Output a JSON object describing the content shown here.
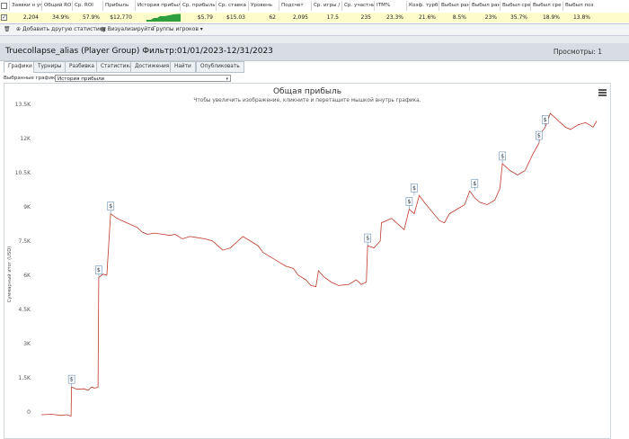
{
  "stats_table": {
    "headers": [
      "Заявки н уп",
      "Общий ROI",
      "Ср. ROI",
      "Прибыль",
      "История прибыли",
      "Ср. прибыль",
      "Ср. ставка",
      "Уровень",
      "Подсчет",
      "Ср. игры / ...",
      "Ср. участни",
      "ITM%",
      "Коэф. турби",
      "Выбыл ран",
      "Выбыл ран",
      "Выбыл сре",
      "Выбыл сре",
      "Выбыл поз"
    ],
    "row": [
      "2,204",
      "34.9%",
      "57.9%",
      "$12,770",
      "",
      "$5.79",
      "$15.03",
      "62",
      "2,095",
      "17.5",
      "235",
      "23.3%",
      "21.6%",
      "8.5%",
      "23%",
      "35.7%",
      "18.9%",
      "13.8%"
    ],
    "checked_mark": "✓"
  },
  "toolbar": {
    "add_stat": "Добавить другую статистику",
    "visualize": "Визуализируйте",
    "player_groups": "Группы игроков"
  },
  "panel": {
    "title": "Truecollapse_alias (Player Group) Фильтр:01/01/2023-12/31/2023",
    "views": "Просмотры: 1",
    "tabs": [
      "Графики",
      "Турниры",
      "Разбивка",
      "Статистика",
      "Достижения",
      "Найти",
      "Опубликовать"
    ],
    "selected_graphs_label": "Выбранные графики:",
    "selected_graph": "История прибыли"
  },
  "chart_data": {
    "type": "line",
    "title": "Общая прибыль",
    "subtitle": "Чтобы увеличить изображение, кликните и перетащите мышкой внутрь графика.",
    "ylabel": "Суммарный итог (USD)",
    "xlabel": "",
    "ylim": [
      -300,
      13500
    ],
    "yticks": [
      0,
      1500,
      3000,
      4500,
      6000,
      7500,
      9000,
      10500,
      12000,
      13500
    ],
    "ytick_labels": [
      "0",
      "1.5K",
      "3K",
      "4.5K",
      "6K",
      "7.5K",
      "9K",
      "10.5K",
      "12K",
      "13.5K"
    ],
    "xlim": [
      0,
      2204
    ],
    "series": [
      {
        "color": "#c0392b",
        "x": [
          0,
          40,
          80,
          100,
          118,
          120,
          140,
          170,
          185,
          200,
          210,
          225,
          228,
          245,
          260,
          275,
          300,
          320,
          340,
          360,
          380,
          400,
          420,
          450,
          480,
          510,
          530,
          560,
          590,
          620,
          650,
          680,
          700,
          720,
          750,
          780,
          800,
          830,
          860,
          880,
          910,
          940,
          970,
          1000,
          1020,
          1050,
          1070,
          1090,
          1100,
          1120,
          1150,
          1180,
          1220,
          1250,
          1270,
          1290,
          1295,
          1320,
          1345,
          1350,
          1370,
          1390,
          1420,
          1440,
          1460,
          1480,
          1500,
          1520,
          1550,
          1580,
          1600,
          1620,
          1650,
          1680,
          1700,
          1720,
          1740,
          1770,
          1800,
          1820,
          1830,
          1860,
          1890,
          1920,
          1950,
          1975,
          1980,
          2000,
          2020,
          2050,
          2080,
          2100,
          2130,
          2160,
          2190,
          2204
        ],
        "y": [
          -120,
          -100,
          -150,
          -120,
          -180,
          1100,
          1000,
          1020,
          950,
          1100,
          1050,
          1080,
          5900,
          6050,
          6000,
          8700,
          8500,
          8400,
          8300,
          8200,
          8100,
          7900,
          7800,
          7850,
          7800,
          7750,
          7800,
          7600,
          7700,
          7650,
          7600,
          7500,
          7300,
          7100,
          7200,
          7500,
          7700,
          7500,
          7300,
          7000,
          6800,
          6600,
          6400,
          6300,
          6000,
          5800,
          5550,
          5500,
          6200,
          5950,
          5700,
          5550,
          5600,
          5800,
          5600,
          5700,
          7300,
          7200,
          7500,
          8300,
          8400,
          8500,
          8200,
          8000,
          8900,
          8700,
          9500,
          9200,
          8800,
          8400,
          8300,
          8700,
          8900,
          9100,
          9700,
          9400,
          9200,
          9100,
          9300,
          9800,
          10900,
          10600,
          10400,
          10600,
          11300,
          11800,
          12200,
          12500,
          13100,
          12800,
          12500,
          12400,
          12600,
          12700,
          12500,
          12770
        ]
      }
    ],
    "markers": [
      {
        "x": 120,
        "y": 1100
      },
      {
        "x": 228,
        "y": 5900
      },
      {
        "x": 275,
        "y": 8700
      },
      {
        "x": 1295,
        "y": 7300
      },
      {
        "x": 1460,
        "y": 8900
      },
      {
        "x": 1480,
        "y": 9500
      },
      {
        "x": 1720,
        "y": 9700
      },
      {
        "x": 1830,
        "y": 10900
      },
      {
        "x": 1975,
        "y": 11800
      },
      {
        "x": 2000,
        "y": 12500
      }
    ],
    "marker_label": "$",
    "grid": false,
    "legend": "none"
  },
  "colors": {
    "highlight_row": "#fffccc",
    "line": "#c0392b",
    "sparkline": "#2e9e3e",
    "titlebar": "#d7dde3"
  }
}
